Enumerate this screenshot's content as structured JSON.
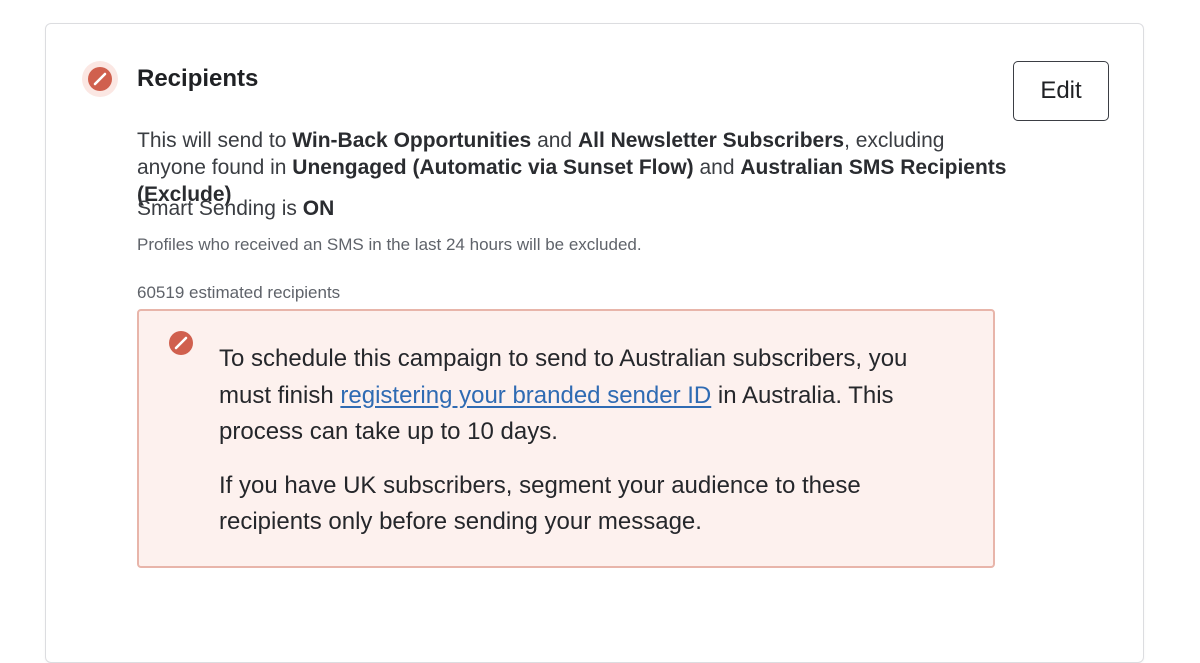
{
  "section": {
    "title": "Recipients",
    "edit_label": "Edit",
    "status_icon": "prohibited-icon",
    "status_color": "#d0604e"
  },
  "summary": {
    "prefix": "This will send to ",
    "list1": "Win-Back Opportunities",
    "and1": " and ",
    "list2": "All Newsletter Subscribers",
    "middle": ", excluding anyone found in ",
    "excl1": "Unengaged (Automatic via Sunset Flow)",
    "and2": " and ",
    "excl2": "Australian SMS Recipients (Exclude)"
  },
  "smart_sending": {
    "prefix": "Smart Sending is ",
    "state": "ON",
    "note": "Profiles who received an SMS in the last 24 hours will be excluded."
  },
  "estimate": "60519 estimated recipients",
  "alert": {
    "icon": "prohibited-icon",
    "border_color": "#e8b5aa",
    "background": "#fdf1ee",
    "p1_before": "To schedule this campaign to send to Australian subscribers, you must finish ",
    "p1_link": "registering your branded sender ID",
    "p1_after": " in Australia. This process can take up to 10 days.",
    "p2": "If you have UK subscribers, segment your audience to these recipients only before sending your message."
  }
}
